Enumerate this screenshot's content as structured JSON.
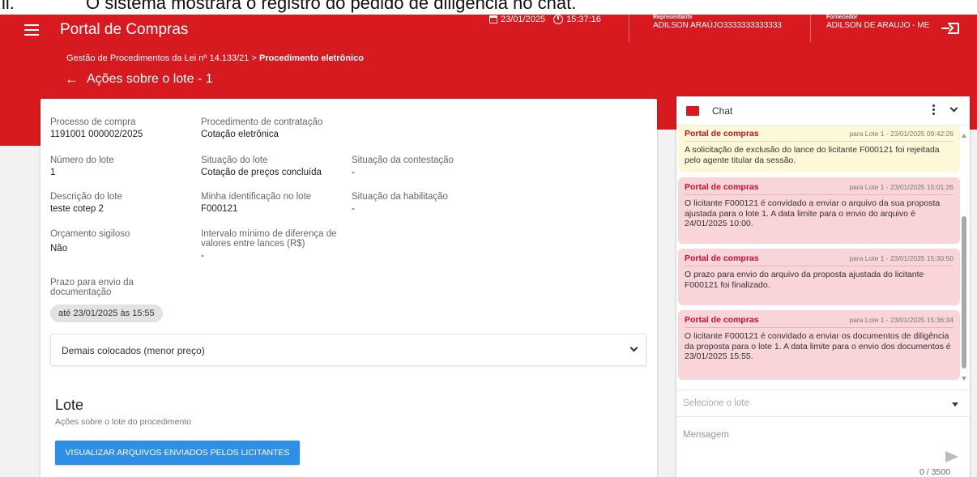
{
  "doc_caption": {
    "number": "ii.",
    "text": "O sistema mostrará o registro do pedido de diligência no chat."
  },
  "header": {
    "app_title": "Portal de Compras",
    "date": "23/01/2025",
    "time": "15:37:16",
    "representante_label": "Representante",
    "representante_value": "ADILSON ARAÚJO3333333333333",
    "fornecedor_label": "Fornecedor",
    "fornecedor_value": "ADILSON DE ARAUJO - ME"
  },
  "breadcrumb": {
    "part1": "Gestão de Procedimentos da Lei nº 14.133/21 > ",
    "part2": "Procedimento eletrônico"
  },
  "page_title": "Ações sobre o lote - 1",
  "details": {
    "processo_label": "Processo de compra",
    "processo_value": "1191001 000002/2025",
    "procedimento_label": "Procedimento de contratação",
    "procedimento_value": "Cotação eletrônica",
    "numero_lote_label": "Número do lote",
    "numero_lote_value": "1",
    "situacao_lote_label": "Situação do lote",
    "situacao_lote_value": "Cotação de preços concluída",
    "situacao_contestacao_label": "Situação da contestação",
    "situacao_contestacao_value": "-",
    "descricao_label": "Descrição do lote",
    "descricao_value": "teste cotep 2",
    "identificacao_label": "Minha identificação no lote",
    "identificacao_value": "F000121",
    "habilitacao_label": "Situação da habilitação",
    "habilitacao_value": "-",
    "orcamento_label": "Orçamento sigiloso",
    "orcamento_value": "Não",
    "intervalo_label": "Intervalo mínimo de diferença de valores entre lances (R$)",
    "intervalo_value": "-",
    "prazo_label": "Prazo para envio da documentação",
    "prazo_badge": "até 23/01/2025 às 15:55"
  },
  "demais_colocados": "Demais colocados (menor preço)",
  "lote": {
    "title": "Lote",
    "subtitle": "Ações sobre o lote do procedimento",
    "button": "VISUALIZAR ARQUIVOS ENVIADOS PELOS LICITANTES"
  },
  "chat": {
    "title": "Chat",
    "messages": [
      {
        "author": "Portal de compras",
        "meta": "para Lote 1 - 23/01/2025 09:42:26",
        "text": "A solicitação de exclusão do lance do licitante F000121 foi rejeitada pelo agente titular da sessão.",
        "color": "#fdf8d7"
      },
      {
        "author": "Portal de compras",
        "meta": "para Lote 1 - 23/01/2025 15:01:26",
        "text": "O licitante F000121 é convidado a enviar o arquivo da sua proposta ajustada para o lote  1. A data limite para o envio do arquivo é 24/01/2025 10:00.",
        "color": "#f9d4d8"
      },
      {
        "author": "Portal de compras",
        "meta": "para Lote 1 - 23/01/2025 15:30:50",
        "text": "O prazo para envio do arquivo da proposta ajustada do licitante F000121 foi finalizado.",
        "color": "#f9d4d8"
      },
      {
        "author": "Portal de compras",
        "meta": "para Lote 1 - 23/01/2025 15:36:34",
        "text": "O licitante F000121 é convidado a enviar os documentos de diligência da proposta para o lote  1. A data limite para o envio dos documentos é 23/01/2025 15:55.",
        "color": "#f9d4d8"
      }
    ],
    "select_placeholder": "Selecione o lote",
    "message_placeholder": "Mensagem",
    "counter": "0 / 3500"
  },
  "colors": {
    "brand_red": "#d71920",
    "button_blue": "#2e8fe5",
    "chat_yellow": "#fdf8d7",
    "chat_pink": "#f9d4d8"
  }
}
